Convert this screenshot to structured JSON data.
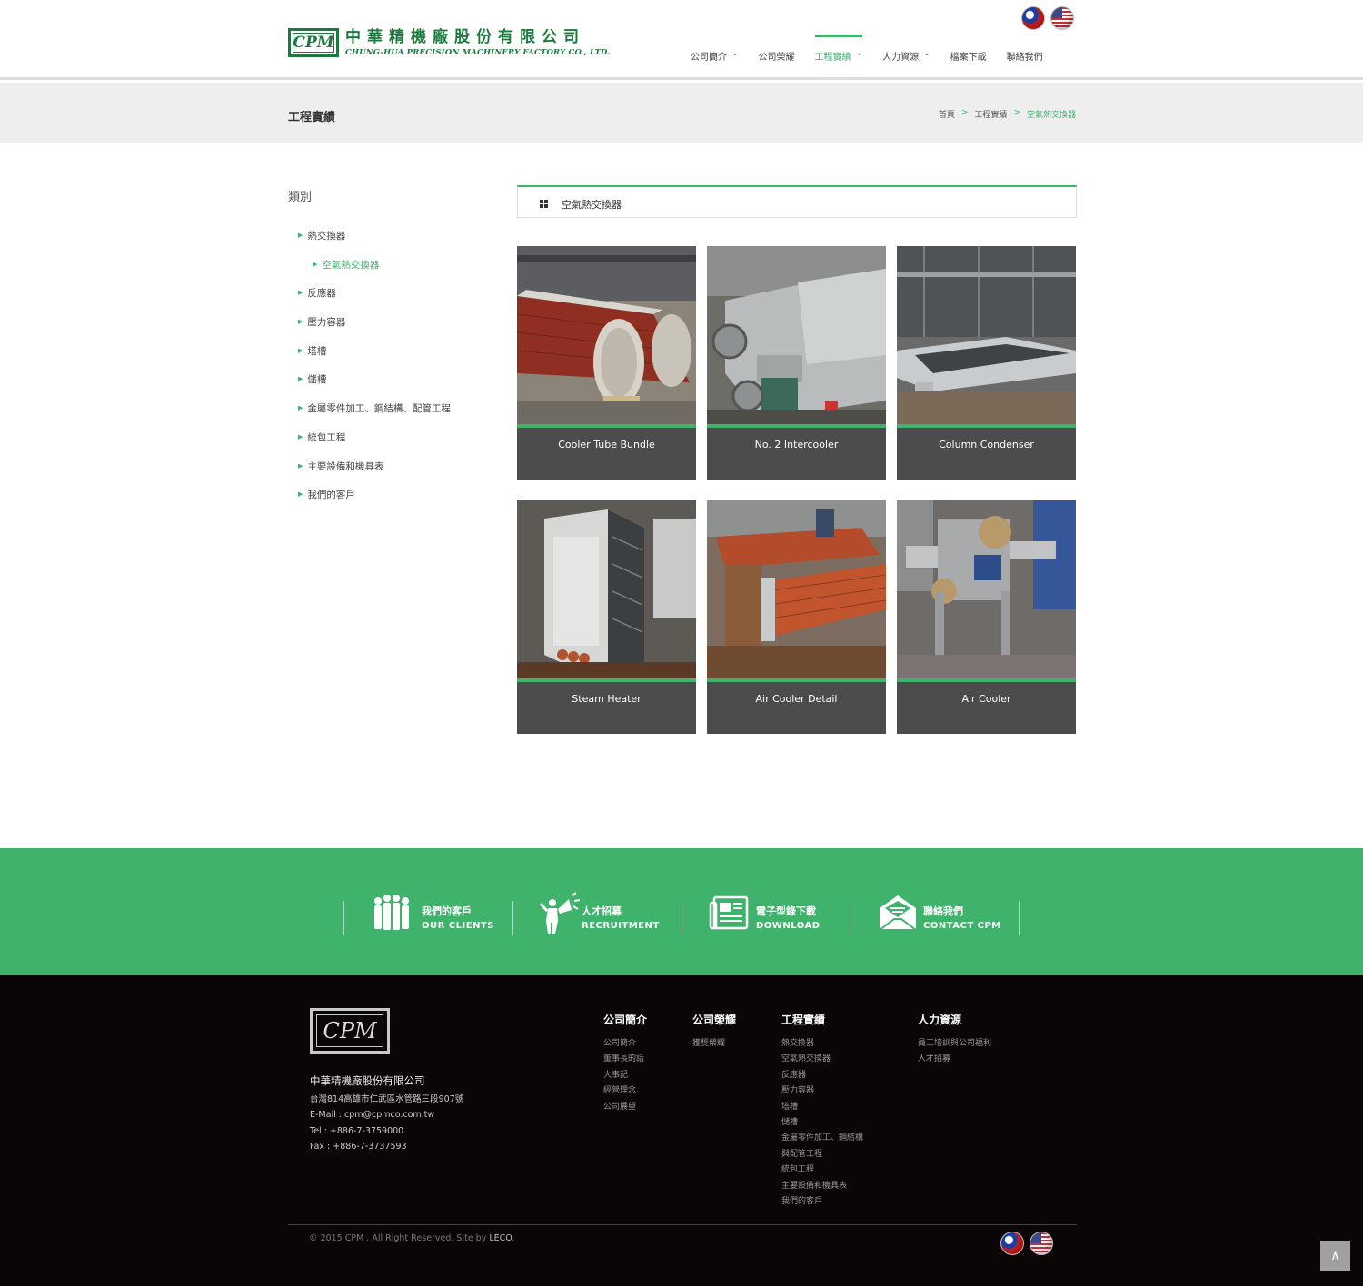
{
  "header": {
    "logo_mark": "CPM",
    "logo_cn": "中華精機廠股份有限公司",
    "logo_en": "CHUNG-HUA PRECISION MACHINERY FACTORY CO., LTD.",
    "nav": [
      {
        "label": "公司簡介",
        "dropdown": true,
        "active": false
      },
      {
        "label": "公司榮耀",
        "dropdown": false,
        "active": false
      },
      {
        "label": "工程實績",
        "dropdown": true,
        "active": true
      },
      {
        "label": "人力資源",
        "dropdown": true,
        "active": false
      },
      {
        "label": "檔案下載",
        "dropdown": false,
        "active": false
      },
      {
        "label": "聯絡我們",
        "dropdown": false,
        "active": false
      }
    ],
    "chevron": "⌄",
    "flags": [
      "taiwan-flag-icon",
      "usa-flag-icon"
    ]
  },
  "band": {
    "title": "工程實績",
    "breadcrumb": [
      "首頁",
      "工程實績",
      "空氣熱交換器"
    ],
    "sep": ">"
  },
  "sidebar": {
    "title": "類別",
    "items": [
      {
        "label": "熱交換器",
        "level": 1,
        "active": false
      },
      {
        "label": "空氣熱交換器",
        "level": 2,
        "active": true
      },
      {
        "label": "反應器",
        "level": 1,
        "active": false
      },
      {
        "label": "壓力容器",
        "level": 1,
        "active": false
      },
      {
        "label": "塔槽",
        "level": 1,
        "active": false
      },
      {
        "label": "儲槽",
        "level": 1,
        "active": false
      },
      {
        "label": "金屬零件加工、鋼結構、配管工程",
        "level": 1,
        "active": false
      },
      {
        "label": "統包工程",
        "level": 1,
        "active": false
      },
      {
        "label": "主要設備和機具表",
        "level": 1,
        "active": false
      },
      {
        "label": "我們的客戶",
        "level": 1,
        "active": false
      }
    ]
  },
  "main": {
    "category": "空氣熱交換器",
    "cards": [
      {
        "caption": "Cooler Tube Bundle"
      },
      {
        "caption": "No. 2 Intercooler"
      },
      {
        "caption": "Column Condenser"
      },
      {
        "caption": "Steam Heater"
      },
      {
        "caption": "Air Cooler Detail"
      },
      {
        "caption": "Air Cooler"
      }
    ]
  },
  "quicklinks": [
    {
      "cn": "我們的客戶",
      "en": "OUR CLIENTS",
      "icon": "people-icon"
    },
    {
      "cn": "人才招募",
      "en": "RECRUITMENT",
      "icon": "megaphone-person-icon"
    },
    {
      "cn": "電子型錄下載",
      "en": "DOWNLOAD",
      "icon": "catalog-icon"
    },
    {
      "cn": "聯絡我們",
      "en": "CONTACT CPM",
      "icon": "envelope-icon"
    }
  ],
  "footer": {
    "logo_mark": "CPM",
    "company": "中華精機廠股份有限公司",
    "address": "台灣814高雄市仁武區水管路三段907號",
    "email": "E-Mail : cpm@cpmco.com.tw",
    "tel": "Tel : +886-7-3759000",
    "fax": "Fax : +886-7-3737593",
    "columns": [
      {
        "heading": "公司簡介",
        "links": [
          "公司簡介",
          "董事長的話",
          "大事記",
          "經營理念",
          "公司展望"
        ]
      },
      {
        "heading": "公司榮耀",
        "links": [
          "獲獎榮耀"
        ]
      },
      {
        "heading": "工程實績",
        "links": [
          "熱交換器",
          "空氣熱交換器",
          "反應器",
          "壓力容器",
          "塔槽",
          "儲槽",
          "金屬零件加工、鋼結構",
          "與配管工程",
          "統包工程",
          "主要設備和機具表",
          "我們的客戶"
        ]
      },
      {
        "heading": "人力資源",
        "links": [
          "員工培訓與公司福利",
          "人才招募"
        ]
      }
    ],
    "copyright": "© 2015 CPM . All Right Reserved. Site by ",
    "site_by": "LECO",
    "copyright_end": ".",
    "to_top": "∧"
  },
  "colors": {
    "accent": "#3fb36c",
    "brand_green": "#1d7a3e",
    "card_bg": "#4c4c4c",
    "footer_bg": "#0a0606"
  }
}
